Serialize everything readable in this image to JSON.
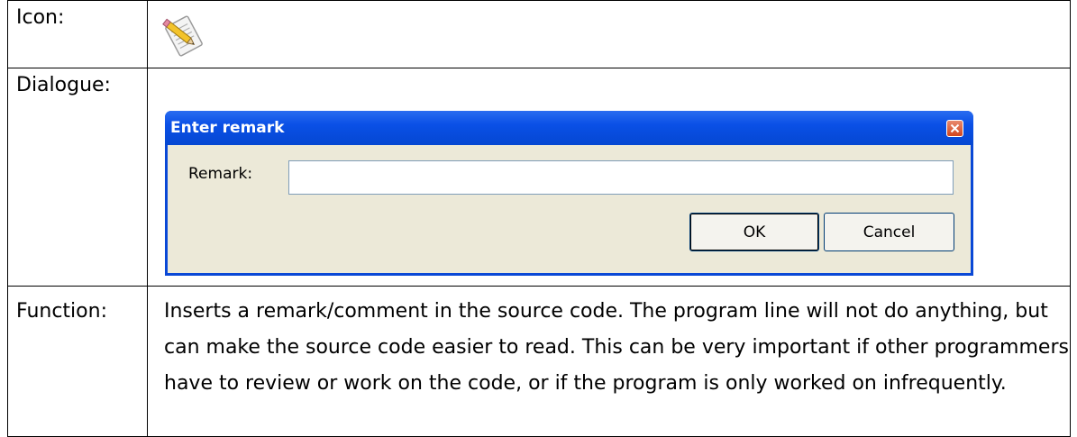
{
  "table": {
    "icon_label": "Icon:",
    "icon_name": "remark-document-pencil-icon",
    "dialogue_label": "Dialogue:",
    "function_label": "Function:",
    "function_text": "Inserts a remark/comment in the source code. The program line will not do anything, but can make the source code easier to read. This can be very important if other programmers have to review or work on the code, or if the program is only worked on infrequently."
  },
  "dialog": {
    "title": "Enter remark",
    "remark_label": "Remark:",
    "remark_value": "",
    "ok_label": "OK",
    "cancel_label": "Cancel",
    "colors": {
      "titlebar": "#0a50e6",
      "client": "#ece9d8",
      "close_button": "#d2451e"
    }
  }
}
